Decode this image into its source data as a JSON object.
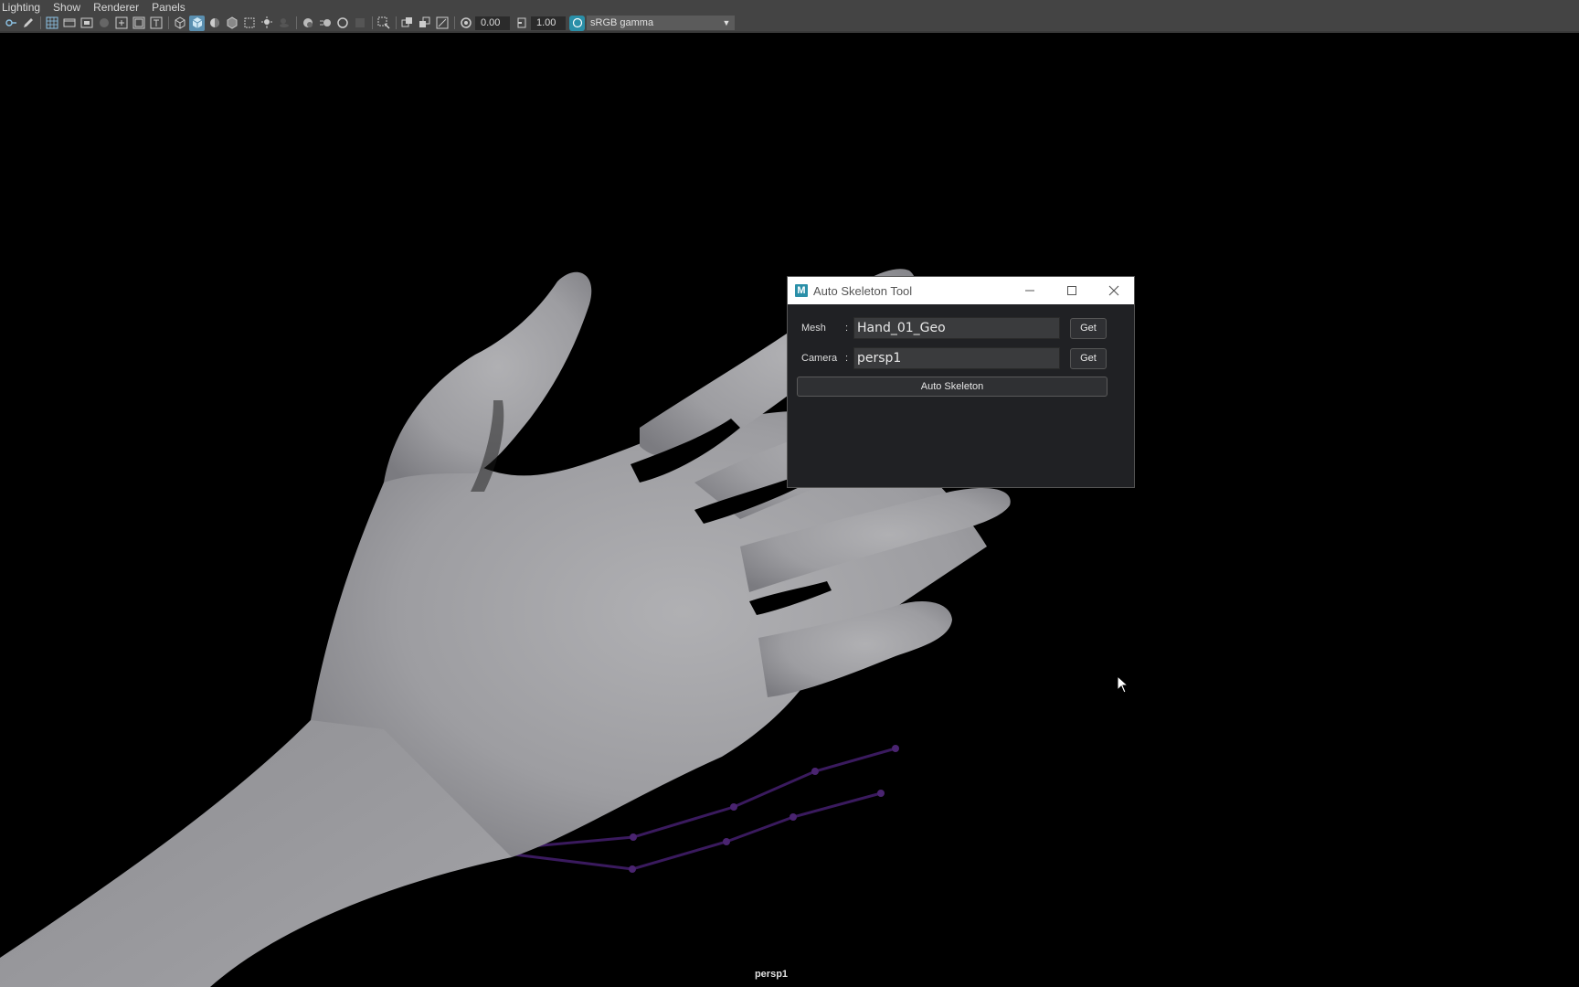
{
  "menubar": {
    "items": [
      {
        "label": "Lighting"
      },
      {
        "label": "Show"
      },
      {
        "label": "Renderer"
      },
      {
        "label": "Panels"
      }
    ]
  },
  "toolbar": {
    "exposure_value": "0.00",
    "gamma_value": "1.00",
    "color_space": "sRGB gamma"
  },
  "viewport": {
    "camera_label": "persp1"
  },
  "dialog": {
    "title": "Auto Skeleton Tool",
    "logo_letter": "M",
    "mesh": {
      "label": "Mesh",
      "colon": ":",
      "value": "Hand_01_Geo",
      "button": "Get"
    },
    "camera": {
      "label": "Camera",
      "colon": ":",
      "value": "persp1",
      "button": "Get"
    },
    "auto_skeleton_button": "Auto Skeleton"
  },
  "colors": {
    "accent": "#5a8fb0",
    "dialog_bg": "#202124",
    "joint_purple": "#3a1a5e"
  }
}
